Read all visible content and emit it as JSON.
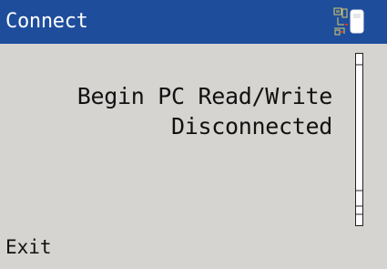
{
  "window": {
    "title": "Connect",
    "status_icon": "pc-connection-icon"
  },
  "main": {
    "line1": "Begin PC Read/Write",
    "line2": "Disconnected"
  },
  "softkeys": {
    "left_label": "Exit"
  },
  "colors": {
    "titlebar": "#1e4d9c",
    "background": "#d6d4d1",
    "text": "#111111",
    "title_text": "#ffffff",
    "icon_accent": "#c8a800"
  }
}
